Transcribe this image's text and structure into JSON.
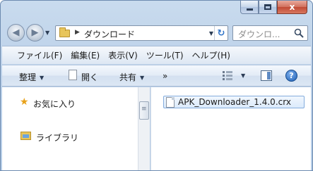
{
  "window": {
    "address": {
      "crumb": "ダウンロード"
    },
    "search": {
      "placeholder": "ダウンロ..."
    },
    "caption_buttons": {
      "close_glyph": "x"
    }
  },
  "menubar": {
    "items": [
      "ファイル(F)",
      "編集(E)",
      "表示(V)",
      "ツール(T)",
      "ヘルプ(H)"
    ]
  },
  "toolbar": {
    "organize": "整理",
    "open": "開く",
    "share": "共有",
    "more": "»",
    "help": "?"
  },
  "nav_pane": {
    "favorites": "お気に入り",
    "libraries": "ライブラリ"
  },
  "files": [
    {
      "name": "APK_Downloader_1.4.0.crx",
      "selected": true
    }
  ],
  "colors": {
    "frame": "#bcd1e9",
    "selection": "#dbeafb",
    "selection_border": "#84acdd",
    "close_button": "#c04a35"
  }
}
